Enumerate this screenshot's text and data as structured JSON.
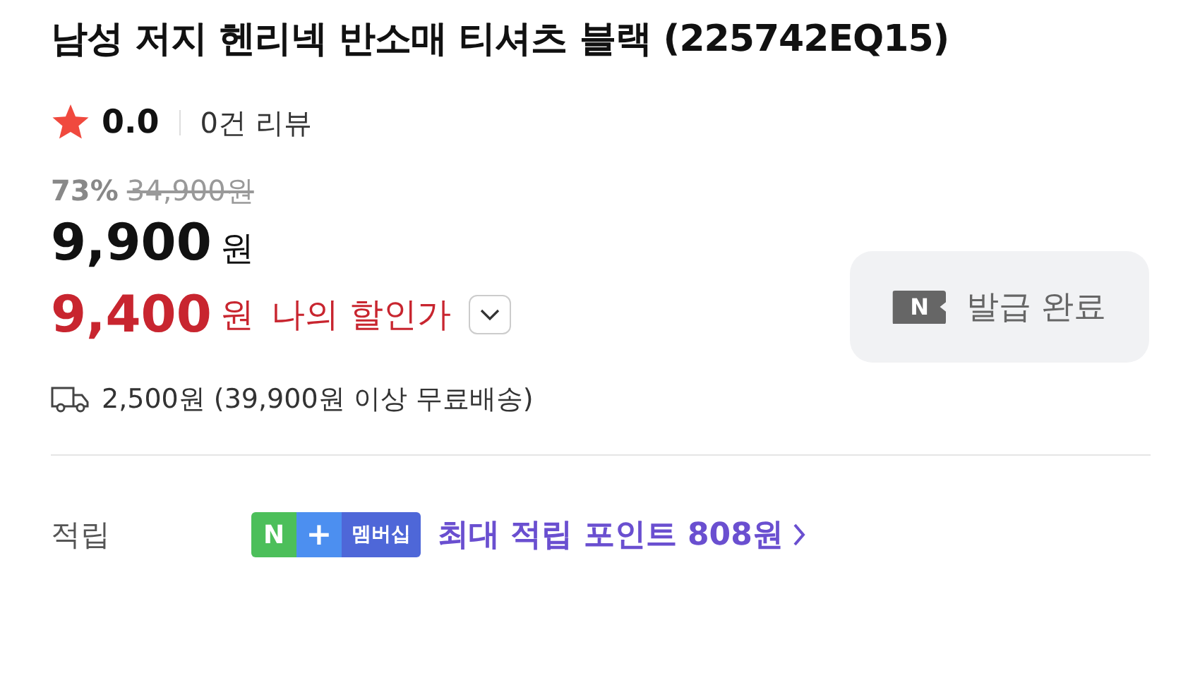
{
  "title": "남성 저지 헨리넥 반소매 티셔츠 블랙 (225742EQ15)",
  "rating": {
    "score": "0.0",
    "reviews": "0건 리뷰"
  },
  "price": {
    "discount": "73%",
    "original": "34,900원",
    "sale": "9,900",
    "sale_unit": "원",
    "my_price": "9,400",
    "my_unit": "원",
    "my_label": "나의 할인가",
    "my_expanded": false
  },
  "coupon": {
    "badge": "N",
    "label": "발급 완료",
    "disabled": true
  },
  "shipping": {
    "text": "2,500원 (39,900원 이상 무료배송)"
  },
  "points": {
    "label": "적립",
    "membership": {
      "n": "N",
      "plus": "+",
      "name": "멤버십"
    },
    "text": "최대 적립 포인트 808원"
  }
}
